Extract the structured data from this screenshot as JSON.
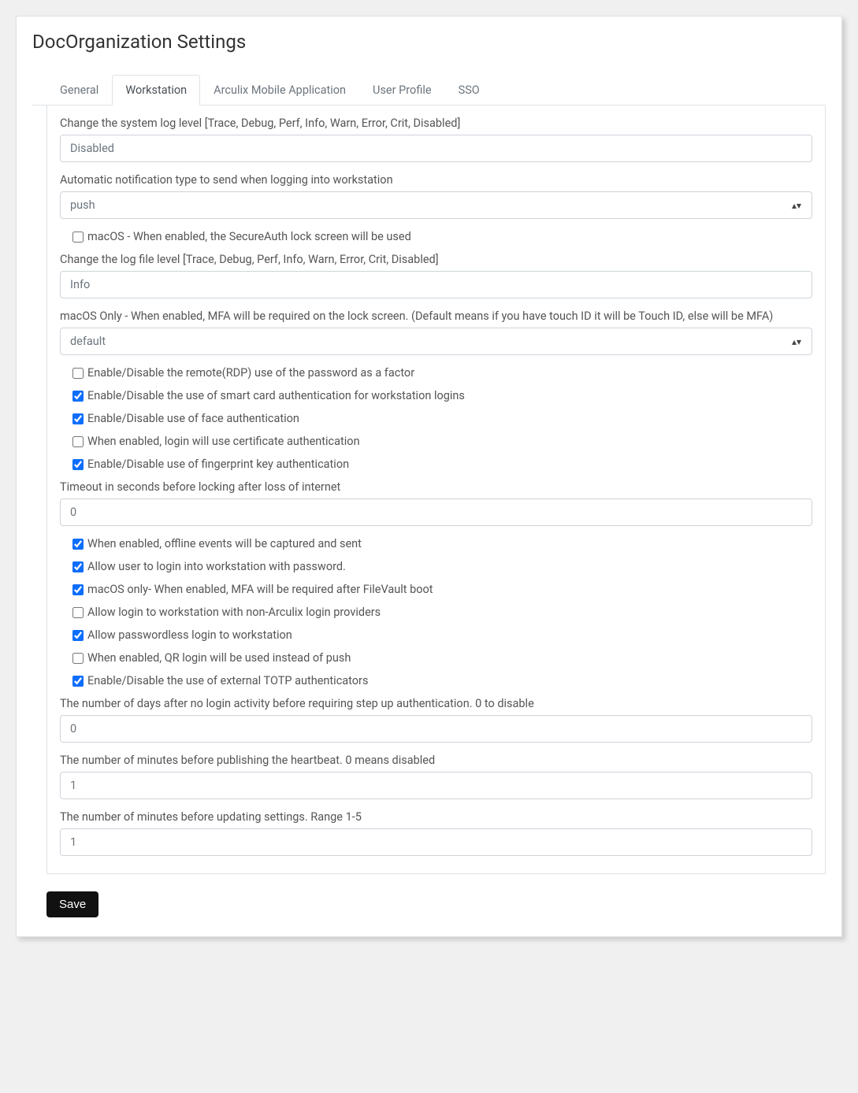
{
  "page_title": "DocOrganization Settings",
  "tabs": [
    {
      "label": "General",
      "active": false
    },
    {
      "label": "Workstation",
      "active": true
    },
    {
      "label": "Arculix Mobile Application",
      "active": false
    },
    {
      "label": "User Profile",
      "active": false
    },
    {
      "label": "SSO",
      "active": false
    }
  ],
  "fields": {
    "sys_log_level": {
      "label": "Change the system log level [Trace, Debug, Perf, Info, Warn, Error, Crit, Disabled]",
      "value": "Disabled"
    },
    "notification_type": {
      "label": "Automatic notification type to send when logging into workstation",
      "value": "push"
    },
    "macos_lockscreen": {
      "label": "macOS - When enabled, the SecureAuth lock screen will be used",
      "checked": false
    },
    "log_file_level": {
      "label": "Change the log file level [Trace, Debug, Perf, Info, Warn, Error, Crit, Disabled]",
      "value": "Info"
    },
    "macos_mfa_lock": {
      "label": "macOS Only - When enabled, MFA will be required on the lock screen. (Default means if you have touch ID it will be Touch ID, else will be MFA)",
      "value": "default"
    },
    "rdp_password": {
      "label": "Enable/Disable the remote(RDP) use of the password as a factor",
      "checked": false
    },
    "smart_card": {
      "label": "Enable/Disable the use of smart card authentication for workstation logins",
      "checked": true
    },
    "face_auth": {
      "label": "Enable/Disable use of face authentication",
      "checked": true
    },
    "cert_auth": {
      "label": "When enabled, login will use certificate authentication",
      "checked": false
    },
    "fingerprint": {
      "label": "Enable/Disable use of fingerprint key authentication",
      "checked": true
    },
    "timeout_lock": {
      "label": "Timeout in seconds before locking after loss of internet",
      "value": "0"
    },
    "offline_events": {
      "label": "When enabled, offline events will be captured and sent",
      "checked": true
    },
    "login_password": {
      "label": "Allow user to login into workstation with password.",
      "checked": true
    },
    "mfa_filevault": {
      "label": "macOS only- When enabled, MFA will be required after FileVault boot",
      "checked": true
    },
    "non_arculix": {
      "label": "Allow login to workstation with non-Arculix login providers",
      "checked": false
    },
    "passwordless": {
      "label": "Allow passwordless login to workstation",
      "checked": true
    },
    "qr_login": {
      "label": "When enabled, QR login will be used instead of push",
      "checked": false
    },
    "external_totp": {
      "label": "Enable/Disable the use of external TOTP authenticators",
      "checked": true
    },
    "stepup_days": {
      "label": "The number of days after no login activity before requiring step up authentication. 0 to disable",
      "value": "0"
    },
    "heartbeat_min": {
      "label": "The number of minutes before publishing the heartbeat. 0 means disabled",
      "value": "1"
    },
    "settings_min": {
      "label": "The number of minutes before updating settings. Range 1-5",
      "value": "1"
    }
  },
  "save_label": "Save"
}
